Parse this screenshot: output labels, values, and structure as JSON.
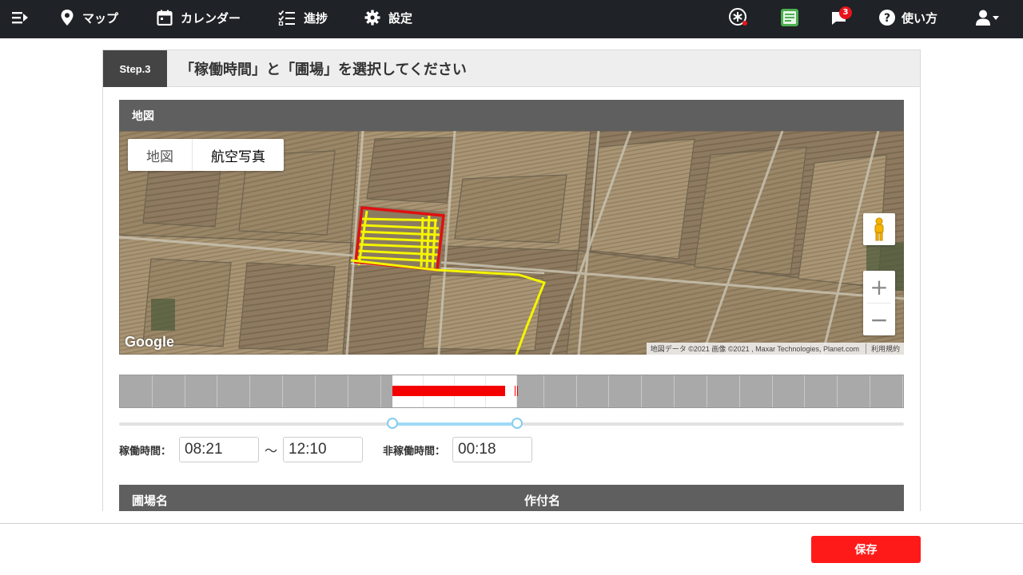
{
  "nav": {
    "menu_icon": "menu-collapse-icon",
    "items": [
      {
        "label": "マップ",
        "icon": "map-pin-icon"
      },
      {
        "label": "カレンダー",
        "icon": "calendar-icon"
      },
      {
        "label": "進捗",
        "icon": "checklist-icon"
      },
      {
        "label": "設定",
        "icon": "gear-icon"
      }
    ],
    "right": {
      "notification_count": "3",
      "help_label": "使い方",
      "icons": [
        "asterisk-circle-icon",
        "green-card-icon",
        "message-bell-icon",
        "help-icon",
        "user-icon"
      ]
    }
  },
  "step": {
    "tag": "Step.3",
    "title": "「稼働時間」と「圃場」を選択してください"
  },
  "map": {
    "header": "地図",
    "type_map": "地図",
    "type_satellite": "航空写真",
    "zoom_in": "+",
    "zoom_out": "−",
    "logo": "Google",
    "attribution": "地図データ ©2021 画像 ©2021 , Maxar Technologies, Planet.com",
    "terms": "利用規約",
    "colors": {
      "field_outline": "#e01010",
      "track": "#f5f500"
    }
  },
  "timeline": {
    "total_slots": 24,
    "selected_start_slot": 8.35,
    "selected_end_slot": 12.17,
    "run_start_slot": 8.35,
    "run_end_slot": 11.8,
    "colors": {
      "run": "#f50000",
      "slider": "#9fd9f5"
    }
  },
  "time": {
    "work_label": "稼働時間：",
    "start": "08:21",
    "separator": "〜",
    "end": "12:10",
    "idle_label": "非稼働時間：",
    "idle": "00:18"
  },
  "fields": {
    "col_field": "圃場名",
    "col_crop": "作付名"
  },
  "footer": {
    "save_label": "保存",
    "save_color": "#ff1a1a"
  }
}
